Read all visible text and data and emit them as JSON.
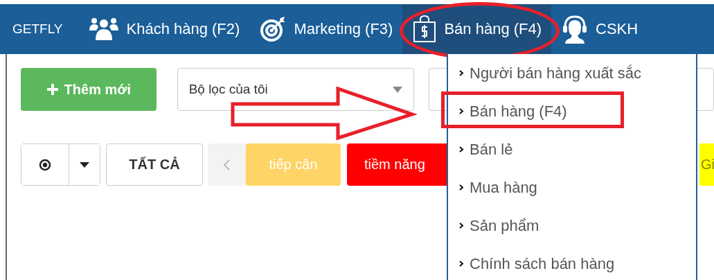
{
  "brand": "GETFLY",
  "nav": [
    {
      "label": "Khách hàng (F2)",
      "kind": "people",
      "selected": false,
      "circled": false
    },
    {
      "label": "Marketing (F3)",
      "kind": "target",
      "selected": false,
      "circled": false
    },
    {
      "label": "Bán hàng (F4)",
      "kind": "bag",
      "selected": true,
      "circled": true
    },
    {
      "label": "CSKH",
      "kind": "headset",
      "selected": false,
      "circled": false
    }
  ],
  "add_button": {
    "label": "Thêm mới"
  },
  "filter": {
    "value": "Bộ lọc của tôi"
  },
  "all_button": {
    "label": "TẤT CẢ"
  },
  "tags": [
    {
      "label": "tiếp cận",
      "color": "#ffd466"
    },
    {
      "label": "tiềm năng",
      "color": "#ff0000"
    },
    {
      "label": "Gi",
      "color": "#ffff00"
    }
  ],
  "menu": [
    {
      "label": "Người bán hàng xuất sắc",
      "boxed": false
    },
    {
      "label": "Bán hàng (F4)",
      "boxed": true
    },
    {
      "label": "Bán lẻ",
      "boxed": false
    },
    {
      "label": "Mua hàng",
      "boxed": false
    },
    {
      "label": "Sản phẩm",
      "boxed": false
    },
    {
      "label": "Chính sách bán hàng",
      "boxed": false
    }
  ],
  "annotations": [
    {
      "kind": "arrow"
    }
  ]
}
